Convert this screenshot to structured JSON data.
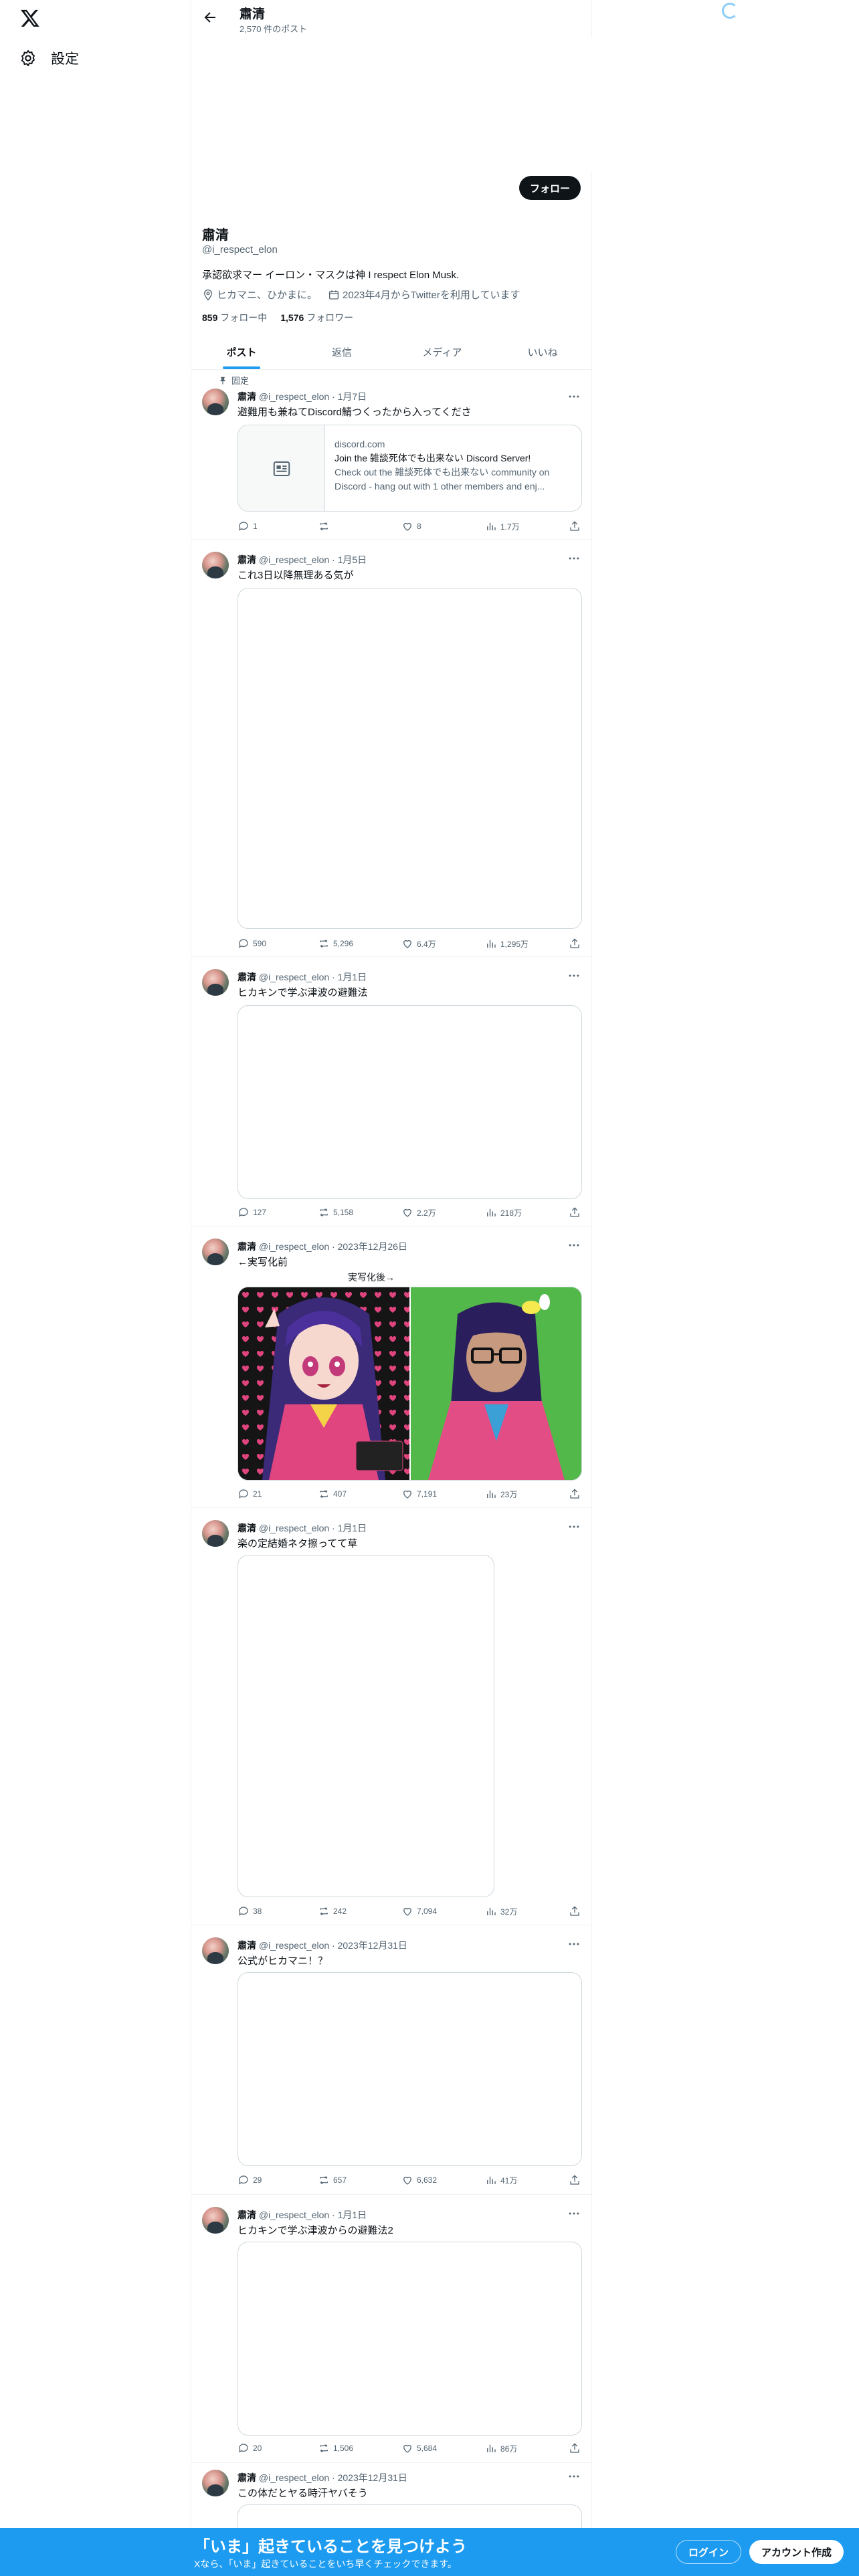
{
  "nav": {
    "settings_label": "設定",
    "logo_icon": "x-logo-icon"
  },
  "header": {
    "name": "肅清",
    "post_count": "2,570 件のポスト"
  },
  "profile": {
    "follow_label": "フォロー",
    "name": "肅清",
    "handle": "@i_respect_elon",
    "bio": "承認欲求マー イーロン・マスクは神 I respect Elon Musk.",
    "location": "ヒカマニ、ひかまに。",
    "joined": "2023年4月からTwitterを利用しています",
    "following_count": "859",
    "following_label": "フォロー中",
    "followers_count": "1,576",
    "followers_label": "フォロワー"
  },
  "tabs": [
    "ポスト",
    "返信",
    "メディア",
    "いいね"
  ],
  "posts": [
    {
      "pinned": "固定",
      "name": "肅清",
      "meta": "@i_respect_elon · 1月7日",
      "text": "避難用も兼ねてDiscord鯖つくったから入ってくださ",
      "card": {
        "domain": "discord.com",
        "title": "Join the 雑談死体でも出来ない Discord Server!",
        "desc1": "Check out the 雑談死体でも出来ない community on",
        "desc2": "Discord - hang out with 1 other members and enj..."
      },
      "stats": {
        "replies": "1",
        "reposts": "",
        "likes": "8",
        "views": "1.7万"
      }
    },
    {
      "name": "肅清",
      "meta": "@i_respect_elon · 1月5日",
      "text": "これ3日以降無理ある気が",
      "stats": {
        "replies": "590",
        "reposts": "5,296",
        "likes": "6.4万",
        "views": "1,295万"
      }
    },
    {
      "name": "肅清",
      "meta": "@i_respect_elon · 1月1日",
      "text": "ヒカキンで学ぶ津波の避難法",
      "stats": {
        "replies": "127",
        "reposts": "5,158",
        "likes": "2.2万",
        "views": "218万"
      }
    },
    {
      "name": "肅清",
      "meta": "@i_respect_elon · 2023年12月26日",
      "text": "←実写化前",
      "caption": "実写化後→",
      "stats": {
        "replies": "21",
        "reposts": "407",
        "likes": "7,191",
        "views": "23万"
      }
    },
    {
      "name": "肅清",
      "meta": "@i_respect_elon · 1月1日",
      "text": "楽の定結婚ネタ擦ってて草",
      "stats": {
        "replies": "38",
        "reposts": "242",
        "likes": "7,094",
        "views": "32万"
      }
    },
    {
      "name": "肅清",
      "meta": "@i_respect_elon · 2023年12月31日",
      "text": "公式がヒカマニ！？",
      "stats": {
        "replies": "29",
        "reposts": "657",
        "likes": "6,632",
        "views": "41万"
      }
    },
    {
      "name": "肅清",
      "meta": "@i_respect_elon · 1月1日",
      "text": "ヒカキンで学ぶ津波からの避難法2",
      "stats": {
        "replies": "20",
        "reposts": "1,506",
        "likes": "5,684",
        "views": "86万"
      }
    },
    {
      "name": "肅清",
      "meta": "@i_respect_elon · 2023年12月31日",
      "text": "この体だとヤる時汗ヤバそう"
    }
  ],
  "bottom_bar": {
    "title": "「いま」起きていることを見つけよう",
    "subtitle": "Xなら、「いま」起きていることをいち早くチェックできます。",
    "login": "ログイン",
    "signup": "アカウント作成",
    "color": "#1d9bf0"
  }
}
